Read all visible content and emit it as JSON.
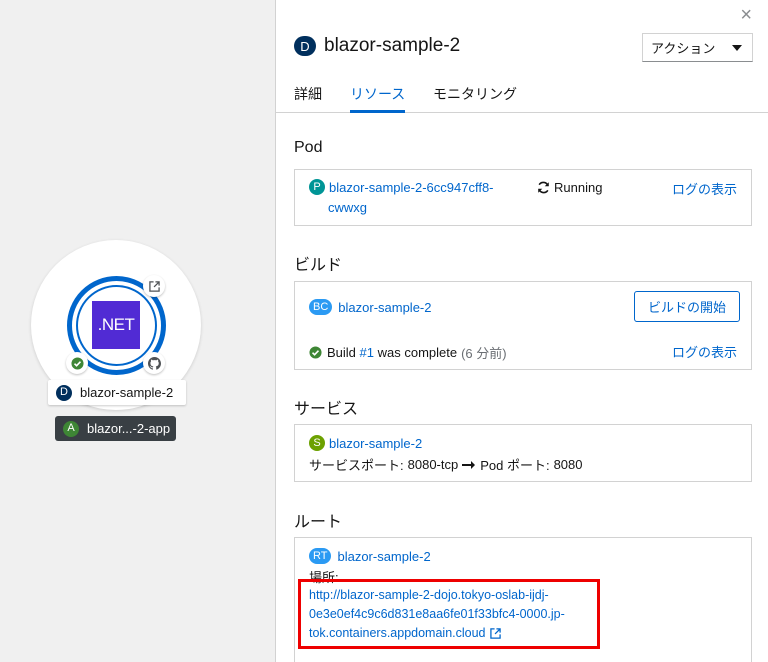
{
  "colors": {
    "accent": "#0066cc",
    "highlight": "#ee0000",
    "net": "#512bd4"
  },
  "topology": {
    "logo_text": ".NET",
    "node": {
      "badge": "D",
      "name": "blazor-sample-2"
    },
    "app": {
      "badge": "A",
      "name": "blazor...-2-app"
    },
    "decorators": [
      "external-link-icon",
      "check-circle-icon",
      "github-icon"
    ]
  },
  "panel": {
    "close": "×",
    "header": {
      "badge": "D",
      "title": "blazor-sample-2"
    },
    "actions_label": "アクション",
    "tabs": [
      "詳細",
      "リソース",
      "モニタリング"
    ],
    "active_tab": "リソース",
    "pod": {
      "section": "Pod",
      "badge": "P",
      "name_line1": "blazor-sample-2-6cc947cff8-",
      "name_line2": "cwwxg",
      "status": "Running",
      "logs": "ログの表示"
    },
    "build": {
      "section": "ビルド",
      "badge": "BC",
      "name": "blazor-sample-2",
      "start_button": "ビルドの開始",
      "status_prefix": "Build ",
      "build_number": "#1",
      "status_suffix": " was complete",
      "age": "(6 分前)",
      "logs": "ログの表示"
    },
    "service": {
      "section": "サービス",
      "badge": "S",
      "name": "blazor-sample-2",
      "port_label": "サービスポート:",
      "port_value": "8080-tcp",
      "pod_port_label": "Pod ポート:",
      "pod_port_value": "8080"
    },
    "route": {
      "section": "ルート",
      "badge": "RT",
      "name": "blazor-sample-2",
      "location_label": "場所:",
      "url_line1": "http://blazor-sample-2-dojo.tokyo-oslab-ijdj-",
      "url_line2": "0e3e0ef4c9c6d831e8aa6fe01f33bfc4-0000.jp-",
      "url_line3": "tok.containers.appdomain.cloud"
    }
  }
}
